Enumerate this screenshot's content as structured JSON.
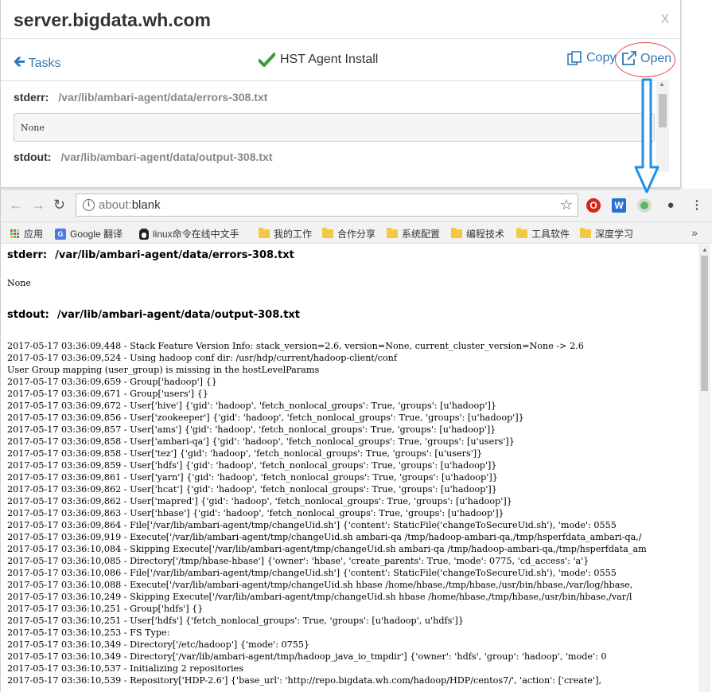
{
  "modal": {
    "title": "server.bigdata.wh.com",
    "close_label": "x",
    "back_label": "Tasks",
    "task_title": "HST Agent Install",
    "copy_label": "Copy",
    "open_label": "Open",
    "stderr_label": "stderr:",
    "stderr_path": "/var/lib/ambari-agent/data/errors-308.txt",
    "stderr_value": "None",
    "stdout_label": "stdout:",
    "stdout_path": "/var/lib/ambari-agent/data/output-308.txt"
  },
  "browser": {
    "url_proto": "about:",
    "url_rest": "blank",
    "extensions": {
      "opera": "O",
      "word": "W"
    },
    "bookmarks": [
      {
        "label": "应用",
        "icon": "apps-grid-icon"
      },
      {
        "label": "Google 翻译",
        "icon": "google-translate-icon"
      },
      {
        "label": "linux命令在线中文手",
        "icon": "tux-icon"
      },
      {
        "label": "我的工作",
        "icon": "folder-icon"
      },
      {
        "label": "合作分享",
        "icon": "folder-icon"
      },
      {
        "label": "系统配置",
        "icon": "folder-icon"
      },
      {
        "label": "编程技术",
        "icon": "folder-icon"
      },
      {
        "label": "工具软件",
        "icon": "folder-icon"
      },
      {
        "label": "深度学习",
        "icon": "folder-icon"
      }
    ],
    "bookmarks_more": "»"
  },
  "page": {
    "stderr_label": "stderr:",
    "stderr_path": "/var/lib/ambari-agent/data/errors-308.txt",
    "stderr_value": "None",
    "stdout_label": "stdout:",
    "stdout_path": "/var/lib/ambari-agent/data/output-308.txt",
    "stdout_lines": [
      "2017-05-17 03:36:09,448 - Stack Feature Version Info: stack_version=2.6, version=None, current_cluster_version=None -> 2.6",
      "2017-05-17 03:36:09,524 - Using hadoop conf dir: /usr/hdp/current/hadoop-client/conf",
      "User Group mapping (user_group) is missing in the hostLevelParams",
      "2017-05-17 03:36:09,659 - Group['hadoop'] {}",
      "2017-05-17 03:36:09,671 - Group['users'] {}",
      "2017-05-17 03:36:09,672 - User['hive'] {'gid': 'hadoop', 'fetch_nonlocal_groups': True, 'groups': [u'hadoop']}",
      "2017-05-17 03:36:09,856 - User['zookeeper'] {'gid': 'hadoop', 'fetch_nonlocal_groups': True, 'groups': [u'hadoop']}",
      "2017-05-17 03:36:09,857 - User['ams'] {'gid': 'hadoop', 'fetch_nonlocal_groups': True, 'groups': [u'hadoop']}",
      "2017-05-17 03:36:09,858 - User['ambari-qa'] {'gid': 'hadoop', 'fetch_nonlocal_groups': True, 'groups': [u'users']}",
      "2017-05-17 03:36:09,858 - User['tez'] {'gid': 'hadoop', 'fetch_nonlocal_groups': True, 'groups': [u'users']}",
      "2017-05-17 03:36:09,859 - User['hdfs'] {'gid': 'hadoop', 'fetch_nonlocal_groups': True, 'groups': [u'hadoop']}",
      "2017-05-17 03:36:09,861 - User['yarn'] {'gid': 'hadoop', 'fetch_nonlocal_groups': True, 'groups': [u'hadoop']}",
      "2017-05-17 03:36:09,862 - User['hcat'] {'gid': 'hadoop', 'fetch_nonlocal_groups': True, 'groups': [u'hadoop']}",
      "2017-05-17 03:36:09,862 - User['mapred'] {'gid': 'hadoop', 'fetch_nonlocal_groups': True, 'groups': [u'hadoop']}",
      "2017-05-17 03:36:09,863 - User['hbase'] {'gid': 'hadoop', 'fetch_nonlocal_groups': True, 'groups': [u'hadoop']}",
      "2017-05-17 03:36:09,864 - File['/var/lib/ambari-agent/tmp/changeUid.sh'] {'content': StaticFile('changeToSecureUid.sh'), 'mode': 0555",
      "2017-05-17 03:36:09,919 - Execute['/var/lib/ambari-agent/tmp/changeUid.sh ambari-qa /tmp/hadoop-ambari-qa,/tmp/hsperfdata_ambari-qa,/",
      "2017-05-17 03:36:10,084 - Skipping Execute['/var/lib/ambari-agent/tmp/changeUid.sh ambari-qa /tmp/hadoop-ambari-qa,/tmp/hsperfdata_am",
      "2017-05-17 03:36:10,085 - Directory['/tmp/hbase-hbase'] {'owner': 'hbase', 'create_parents': True, 'mode': 0775, 'cd_access': 'a'}",
      "2017-05-17 03:36:10,086 - File['/var/lib/ambari-agent/tmp/changeUid.sh'] {'content': StaticFile('changeToSecureUid.sh'), 'mode': 0555",
      "2017-05-17 03:36:10,088 - Execute['/var/lib/ambari-agent/tmp/changeUid.sh hbase /home/hbase,/tmp/hbase,/usr/bin/hbase,/var/log/hbase,",
      "2017-05-17 03:36:10,249 - Skipping Execute['/var/lib/ambari-agent/tmp/changeUid.sh hbase /home/hbase,/tmp/hbase,/usr/bin/hbase,/var/l",
      "2017-05-17 03:36:10,251 - Group['hdfs'] {}",
      "2017-05-17 03:36:10,251 - User['hdfs'] {'fetch_nonlocal_groups': True, 'groups': [u'hadoop', u'hdfs']}",
      "2017-05-17 03:36:10,253 - FS Type:",
      "2017-05-17 03:36:10,349 - Directory['/etc/hadoop'] {'mode': 0755}",
      "2017-05-17 03:36:10,349 - Directory['/var/lib/ambari-agent/tmp/hadoop_java_io_tmpdir'] {'owner': 'hdfs', 'group': 'hadoop', 'mode': 0",
      "2017-05-17 03:36:10,537 - Initializing 2 repositories",
      "2017-05-17 03:36:10,539 - Repository['HDP-2.6'] {'base_url': 'http://repo.bigdata.wh.com/hadoop/HDP/centos7/', 'action': ['create'],"
    ]
  }
}
